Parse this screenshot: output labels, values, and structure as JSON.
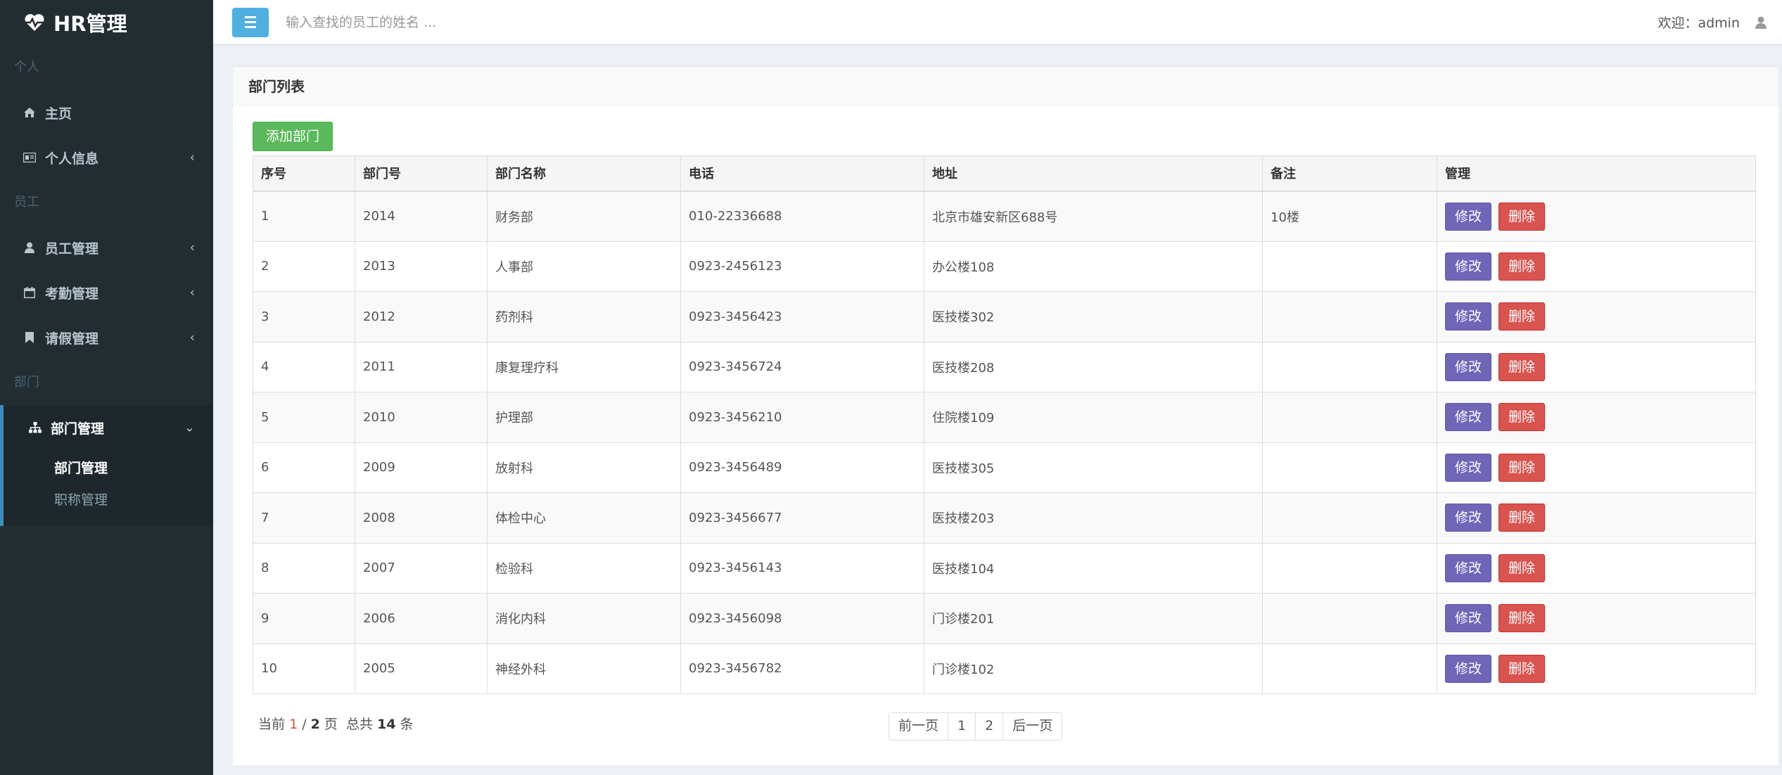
{
  "app": {
    "logo_text": "HR管理"
  },
  "sidebar": {
    "sections": [
      {
        "header": "个人"
      },
      {
        "header": "员工"
      },
      {
        "header": "部门"
      }
    ],
    "items": [
      {
        "label": "主页",
        "icon": "home-icon"
      },
      {
        "label": "个人信息",
        "icon": "id-card-icon",
        "chevron": "‹"
      },
      {
        "label": "员工管理",
        "icon": "user-icon",
        "chevron": "‹"
      },
      {
        "label": "考勤管理",
        "icon": "calendar-icon",
        "chevron": "‹"
      },
      {
        "label": "请假管理",
        "icon": "bookmark-icon",
        "chevron": "‹"
      },
      {
        "label": "部门管理",
        "icon": "sitemap-icon",
        "chevron": "⌄"
      }
    ],
    "submenu": [
      {
        "label": "部门管理"
      },
      {
        "label": "职称管理"
      }
    ]
  },
  "header": {
    "search_placeholder": "输入查找的员工的姓名 ...",
    "welcome": "欢迎：admin"
  },
  "main": {
    "box_title": "部门列表",
    "add_button": "添加部门",
    "columns": [
      "序号",
      "部门号",
      "部门名称",
      "电话",
      "地址",
      "备注",
      "管理"
    ],
    "rows": [
      [
        "1",
        "2014",
        "财务部",
        "010-22336688",
        "北京市雄安新区688号",
        "10楼"
      ],
      [
        "2",
        "2013",
        "人事部",
        "0923-2456123",
        "办公楼108",
        ""
      ],
      [
        "3",
        "2012",
        "药剂科",
        "0923-3456423",
        "医技楼302",
        ""
      ],
      [
        "4",
        "2011",
        "康复理疗科",
        "0923-3456724",
        "医技楼208",
        ""
      ],
      [
        "5",
        "2010",
        "护理部",
        "0923-3456210",
        "住院楼109",
        ""
      ],
      [
        "6",
        "2009",
        "放射科",
        "0923-3456489",
        "医技楼305",
        ""
      ],
      [
        "7",
        "2008",
        "体检中心",
        "0923-3456677",
        "医技楼203",
        ""
      ],
      [
        "8",
        "2007",
        "检验科",
        "0923-3456143",
        "医技楼104",
        ""
      ],
      [
        "9",
        "2006",
        "消化内科",
        "0923-3456098",
        "门诊楼201",
        ""
      ],
      [
        "10",
        "2005",
        "神经外科",
        "0923-3456782",
        "门诊楼102",
        ""
      ]
    ],
    "edit_label": "修改",
    "delete_label": "删除",
    "pagination": {
      "prefix": "当前",
      "current": "1",
      "sep": " / ",
      "total_pages": "2",
      "page_word": "页",
      "total_prefix": "总共",
      "total": "14",
      "count_word": "条",
      "buttons": [
        "前一页",
        "1",
        "2",
        "后一页"
      ]
    }
  },
  "colors": {
    "sidebar_bg": "#222d32",
    "accent": "#3c8dbc",
    "edit_button": "#6f66b8",
    "delete_button": "#d9534f",
    "add_button": "#5cb85c"
  }
}
